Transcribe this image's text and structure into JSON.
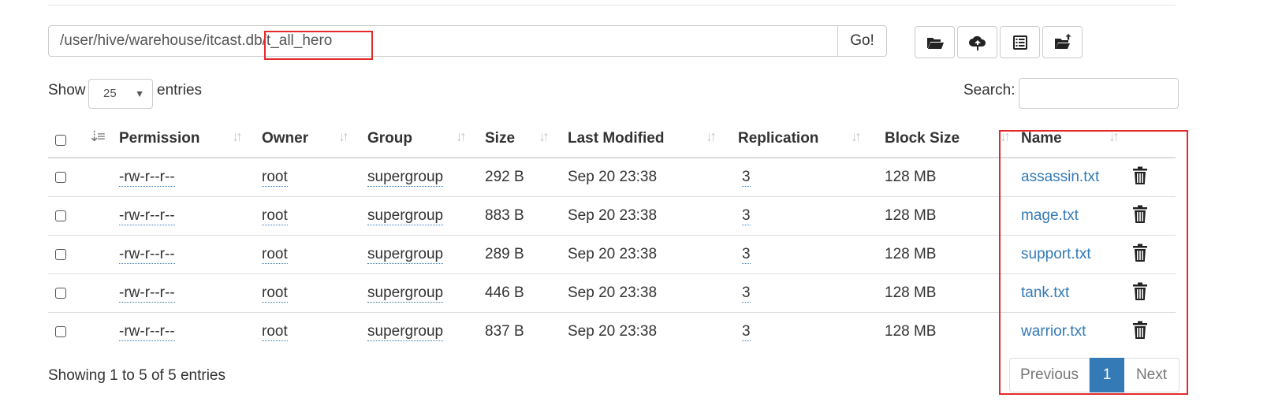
{
  "path_bar": {
    "path_value": "/user/hive/warehouse/itcast.db/t_all_hero",
    "go_label": "Go!"
  },
  "toolbar": [
    {
      "icon": "folder-open-icon"
    },
    {
      "icon": "cloud-upload-icon"
    },
    {
      "icon": "list-alt-icon"
    },
    {
      "icon": "folder-upload-icon"
    }
  ],
  "length_control": {
    "show_label": "Show",
    "selected": "25",
    "entries_label": "entries"
  },
  "search": {
    "label": "Search:",
    "value": ""
  },
  "table": {
    "columns": [
      "Permission",
      "Owner",
      "Group",
      "Size",
      "Last Modified",
      "Replication",
      "Block Size",
      "Name"
    ],
    "rows": [
      {
        "permission": "-rw-r--r--",
        "owner": "root",
        "group": "supergroup",
        "size": "292 B",
        "modified": "Sep 20 23:38",
        "replication": "3",
        "block_size": "128 MB",
        "name": "assassin.txt"
      },
      {
        "permission": "-rw-r--r--",
        "owner": "root",
        "group": "supergroup",
        "size": "883 B",
        "modified": "Sep 20 23:38",
        "replication": "3",
        "block_size": "128 MB",
        "name": "mage.txt"
      },
      {
        "permission": "-rw-r--r--",
        "owner": "root",
        "group": "supergroup",
        "size": "289 B",
        "modified": "Sep 20 23:38",
        "replication": "3",
        "block_size": "128 MB",
        "name": "support.txt"
      },
      {
        "permission": "-rw-r--r--",
        "owner": "root",
        "group": "supergroup",
        "size": "446 B",
        "modified": "Sep 20 23:38",
        "replication": "3",
        "block_size": "128 MB",
        "name": "tank.txt"
      },
      {
        "permission": "-rw-r--r--",
        "owner": "root",
        "group": "supergroup",
        "size": "837 B",
        "modified": "Sep 20 23:38",
        "replication": "3",
        "block_size": "128 MB",
        "name": "warrior.txt"
      }
    ]
  },
  "footer": {
    "info": "Showing 1 to 5 of 5 entries",
    "previous": "Previous",
    "current_page": "1",
    "next": "Next"
  },
  "colors": {
    "link": "#337ab7",
    "highlight": "#e32a2a",
    "active_page": "#337ab7"
  }
}
